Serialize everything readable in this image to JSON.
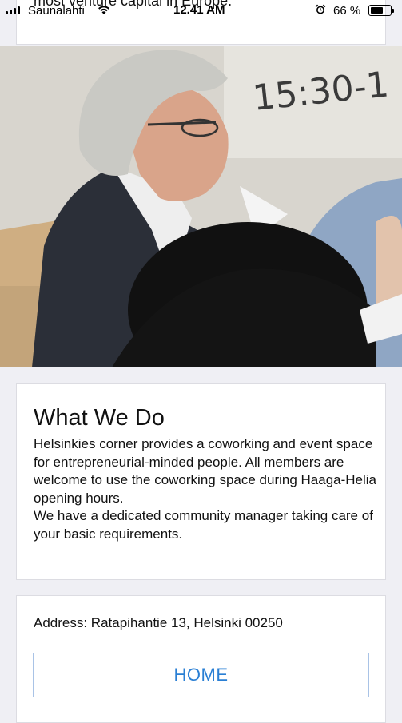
{
  "status_bar": {
    "carrier": "Saunalahti",
    "time": "12.41 AM",
    "battery_percent": "66 %",
    "battery_level": 0.66
  },
  "scrolled_text": "most venture capital in Europe.",
  "hero": {
    "board_text": "15:30-1"
  },
  "what_we_do": {
    "title": "What We Do",
    "paragraph_1": "Helsinkies corner provides a coworking and event space for entrepreneurial-minded people. All members are welcome to use the coworking space during Haaga-Helia opening hours.",
    "paragraph_2": "We have a dedicated community manager taking care of your basic requirements."
  },
  "contact": {
    "address": "Address: Ratapihantie 13, Helsinki 00250",
    "home_button": "HOME"
  },
  "colors": {
    "background": "#efeff4",
    "button_text": "#2a7fd4",
    "button_border": "#a9c3e6"
  }
}
